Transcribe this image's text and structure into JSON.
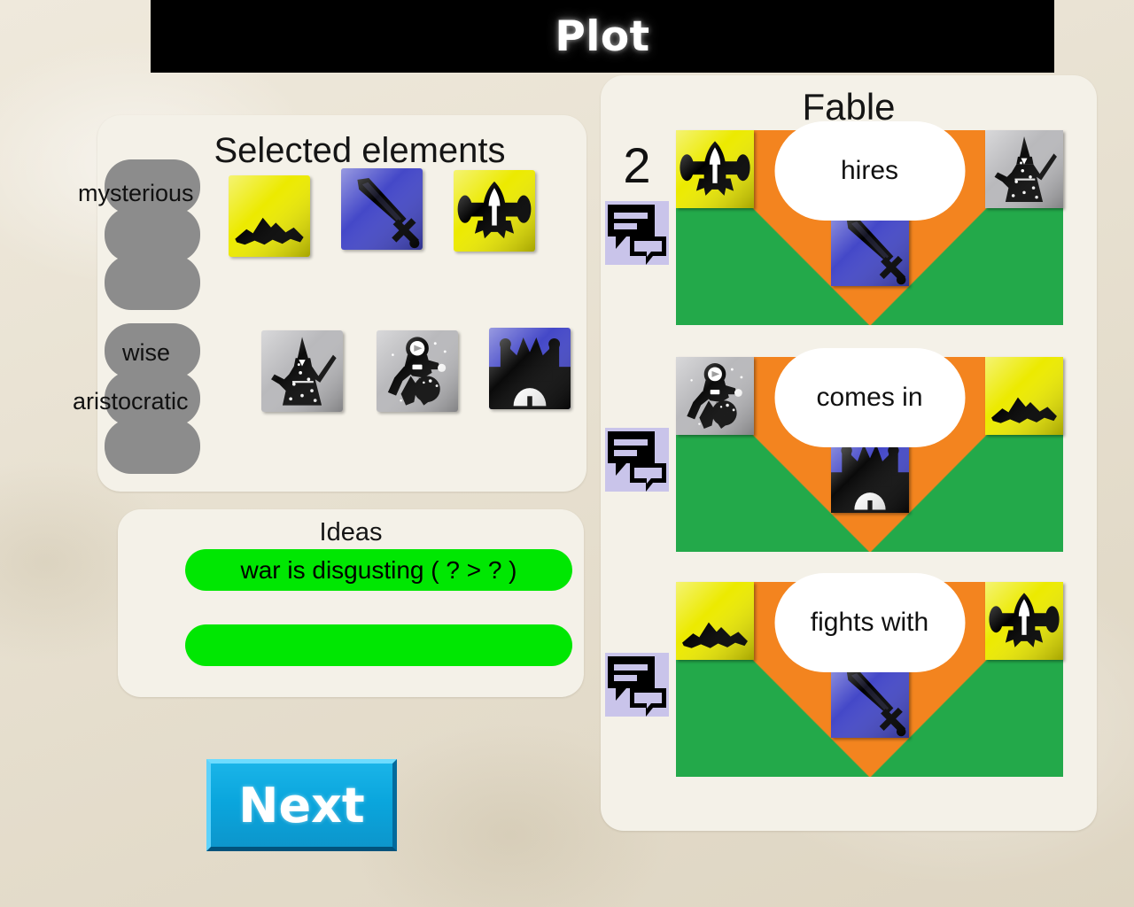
{
  "app": {
    "title": "Plot"
  },
  "selected_panel": {
    "title": "Selected elements",
    "rows": [
      {
        "tags": [
          "mysterious",
          "",
          ""
        ],
        "tiles": [
          {
            "icon": "mountain-icon",
            "bg": "#ecea00"
          },
          {
            "icon": "sword-icon",
            "bg": "#4448c8"
          },
          {
            "icon": "airplane-icon",
            "bg": "#ecea00"
          }
        ]
      },
      {
        "tags": [
          "wise",
          "aristocratic",
          ""
        ],
        "tiles": [
          {
            "icon": "wizard-icon",
            "bg": "#b9b9bc"
          },
          {
            "icon": "astronaut-icon",
            "bg": "#b9b9bc"
          },
          {
            "icon": "castle-icon",
            "bg": "#4448c8"
          }
        ]
      }
    ]
  },
  "ideas_panel": {
    "title": "Ideas",
    "items": [
      {
        "text": "war is disgusting ( ? > ? )"
      },
      {
        "text": ""
      }
    ],
    "pill_color": "#00e702"
  },
  "next_button": {
    "label": "Next"
  },
  "fable_panel": {
    "title": "Fable",
    "rows": [
      {
        "number": "2",
        "badge_icon": "speech-bubble-icon",
        "relation": "hires",
        "left_icon": "airplane-icon",
        "left_bg": "#ecea00",
        "mid_icon": "sword-icon",
        "mid_bg": "#4448c8",
        "right_icon": "wizard-icon",
        "right_bg": "#b9b9bc"
      },
      {
        "number": "",
        "badge_icon": "speech-bubble-icon",
        "relation": "comes in",
        "left_icon": "astronaut-icon",
        "left_bg": "#b9b9bc",
        "mid_icon": "castle-icon",
        "mid_bg": "#4448c8",
        "right_icon": "mountain-icon",
        "right_bg": "#ecea00"
      },
      {
        "number": "",
        "badge_icon": "speech-bubble-icon",
        "relation": "fights with",
        "left_icon": "mountain-icon",
        "left_bg": "#ecea00",
        "mid_icon": "sword-icon",
        "mid_bg": "#4448c8",
        "right_icon": "airplane-icon",
        "right_bg": "#ecea00"
      }
    ],
    "scene_colors": {
      "orange": "#f3841f",
      "green": "#23a94a"
    }
  }
}
